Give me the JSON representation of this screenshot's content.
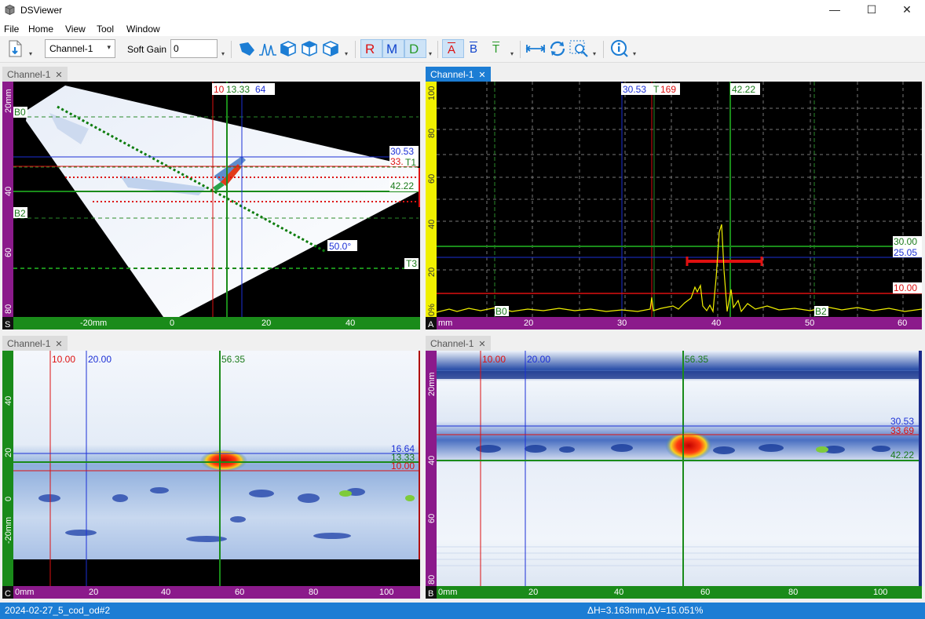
{
  "app": {
    "title": "DSViewer"
  },
  "window": {
    "minimize": "—",
    "maximize": "☐",
    "close": "✕"
  },
  "menu": [
    "File",
    "Home",
    "View",
    "Tool",
    "Window"
  ],
  "toolbar": {
    "channel_value": "Channel-1",
    "soft_gain_label": "Soft Gain",
    "soft_gain_value": "0",
    "cursor_buttons": [
      "R",
      "M",
      "D"
    ],
    "gate_buttons": [
      "A",
      "B",
      "T"
    ]
  },
  "panels": {
    "s_scan": {
      "tab": "Channel-1",
      "view_letter": "S",
      "top_labels": [
        "10",
        "13.33",
        "64"
      ],
      "left_labels": [
        "B0",
        "B2"
      ],
      "right_labels": [
        "30.53",
        "33.",
        "T1",
        "42.22",
        "T3"
      ],
      "angle_label": "50.0°",
      "y_ticks": [
        "20mm",
        "40",
        "60",
        "80"
      ],
      "x_ticks": [
        "-20mm",
        "0",
        "20",
        "40"
      ]
    },
    "a_scan": {
      "tab": "Channel-1",
      "view_letter": "A",
      "top_labels": [
        "30.53",
        "T",
        "169",
        "42.22"
      ],
      "right_labels": [
        "30.00",
        "25.05",
        "10.00"
      ],
      "bottom_labels": [
        "B0",
        "B2"
      ],
      "y_ticks": [
        "100",
        "80",
        "60",
        "40",
        "20",
        "0%"
      ],
      "x_ticks": [
        "mm",
        "20",
        "30",
        "40",
        "50",
        "60"
      ]
    },
    "c_scan": {
      "tab": "Channel-1",
      "view_letter": "C",
      "top_labels": [
        "10.00",
        "20.00",
        "56.35"
      ],
      "right_labels": [
        "16.64",
        "13.33",
        "10.00"
      ],
      "y_ticks": [
        "40",
        "20",
        "0",
        "-20mm"
      ],
      "x_ticks": [
        "0mm",
        "20",
        "40",
        "60",
        "80",
        "100"
      ]
    },
    "b_scan": {
      "tab": "Channel-1",
      "view_letter": "B",
      "top_labels": [
        "10.00",
        "20.00",
        "56.35"
      ],
      "right_labels": [
        "30.53",
        "33.69",
        "42.22"
      ],
      "y_ticks": [
        "20mm",
        "40",
        "60",
        "80"
      ],
      "x_ticks": [
        "0mm",
        "20",
        "40",
        "60",
        "80",
        "100"
      ]
    }
  },
  "status": {
    "file": "2024-02-27_5_cod_od#2",
    "delta": "ΔH=3.163mm,ΔV=15.051%"
  },
  "colors": {
    "accent": "#1c7dd4",
    "axis_purple": "#8b1a8b",
    "axis_green": "#1a8b1a",
    "axis_yellow": "#f0f000"
  }
}
